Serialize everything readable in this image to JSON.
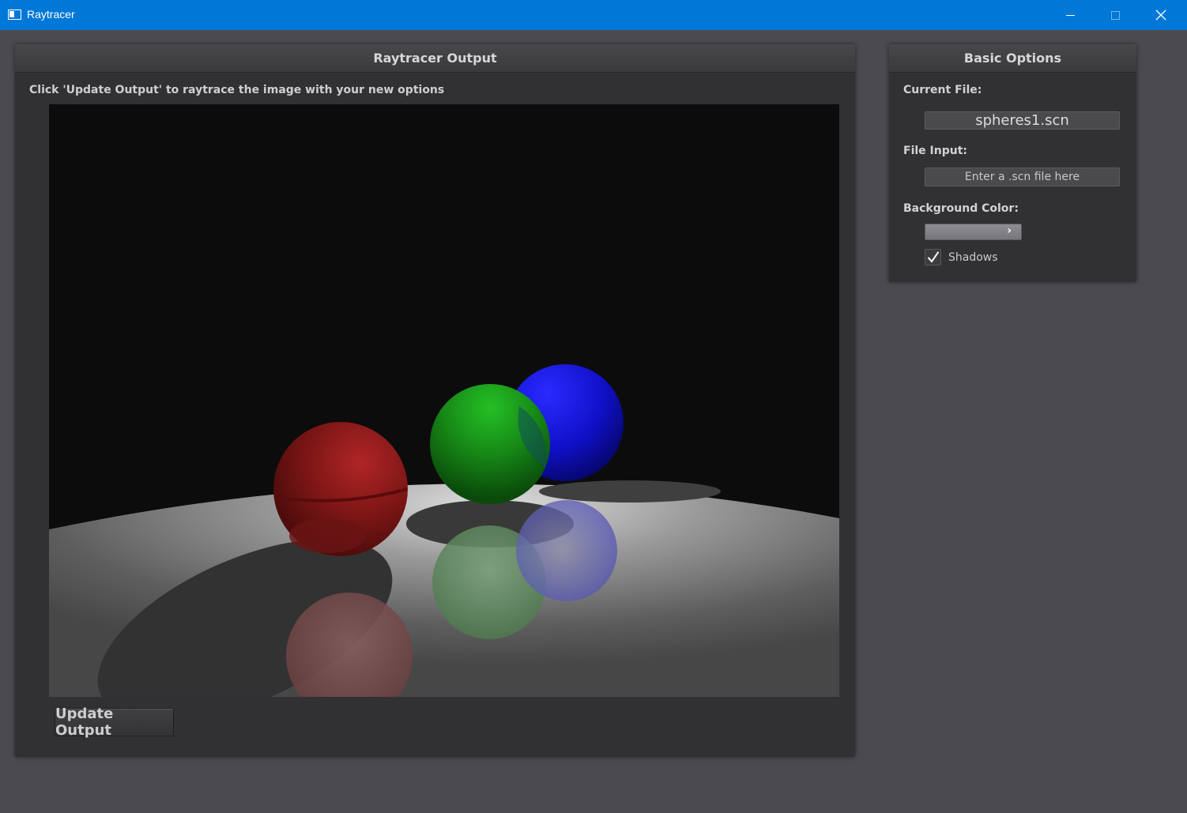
{
  "window": {
    "title": "Raytracer",
    "titlebar_color": "#0078d7"
  },
  "output_panel": {
    "title": "Raytracer Output",
    "instruction": "Click 'Update Output' to raytrace the image with your new options",
    "update_button": "Update Output",
    "render": {
      "description_icon": "raytraced-scene",
      "spheres": [
        "red",
        "green",
        "blue"
      ]
    }
  },
  "options_panel": {
    "title": "Basic Options",
    "current_file_label": "Current File:",
    "current_file_value": "spheres1.scn",
    "file_input_label": "File Input:",
    "file_input_placeholder": "Enter a .scn file here",
    "file_input_value": "",
    "background_color_label": "Background Color:",
    "background_color_icon": "chevron-right-icon",
    "shadows_label": "Shadows",
    "shadows_checked": true
  }
}
